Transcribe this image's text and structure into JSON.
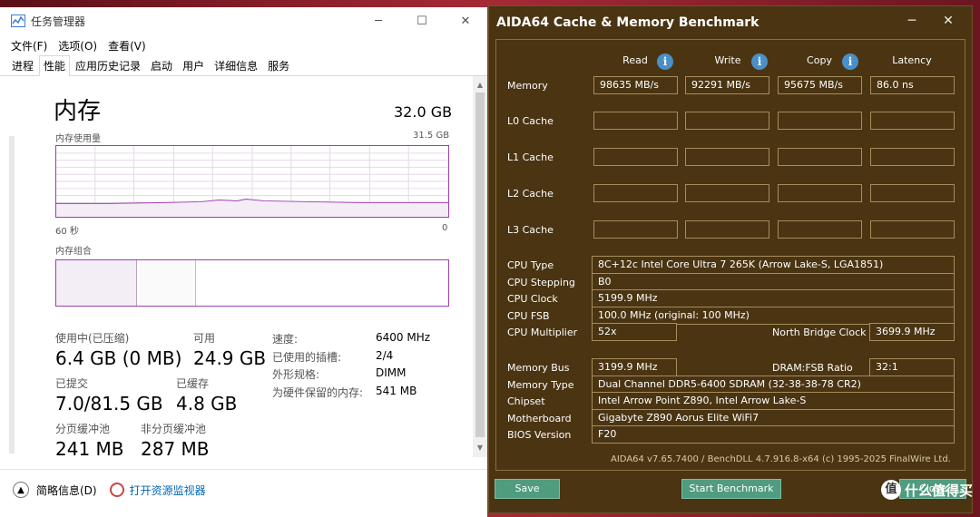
{
  "tm": {
    "title": "任务管理器",
    "menu": [
      "文件(F)",
      "选项(O)",
      "查看(V)"
    ],
    "tabs": [
      "进程",
      "性能",
      "应用历史记录",
      "启动",
      "用户",
      "详细信息",
      "服务"
    ],
    "active_tab": "性能",
    "heading": "内存",
    "total": "32.0 GB",
    "usage_label": "内存使用量",
    "usage_max": "31.5 GB",
    "axis_left": "60 秒",
    "axis_right": "0",
    "composition_label": "内存组合",
    "in_use_label": "使用中(已压缩)",
    "in_use_value": "6.4 GB (0 MB)",
    "available_label": "可用",
    "available_value": "24.9 GB",
    "committed_label": "已提交",
    "committed_value": "7.0/81.5 GB",
    "cached_label": "已缓存",
    "cached_value": "4.8 GB",
    "paged_label": "分页缓冲池",
    "paged_value": "241 MB",
    "nonpaged_label": "非分页缓冲池",
    "nonpaged_value": "287 MB",
    "speed_label": "速度:",
    "speed_value": "6400 MHz",
    "slots_label": "已使用的插槽:",
    "slots_value": "2/4",
    "form_label": "外形规格:",
    "form_value": "DIMM",
    "reserved_label": "为硬件保留的内存:",
    "reserved_value": "541 MB",
    "fewer_details": "简略信息(D)",
    "open_monitor": "打开资源监视器",
    "accent_color": "#9c3fae"
  },
  "aida": {
    "title": "AIDA64 Cache & Memory Benchmark",
    "col_read": "Read",
    "col_write": "Write",
    "col_copy": "Copy",
    "col_latency": "Latency",
    "memory_label": "Memory",
    "memory_read": "98635 MB/s",
    "memory_write": "92291 MB/s",
    "memory_copy": "95675 MB/s",
    "memory_latency": "86.0 ns",
    "l0_label": "L0 Cache",
    "l1_label": "L1 Cache",
    "l2_label": "L2 Cache",
    "l3_label": "L3 Cache",
    "cpu_type_label": "CPU Type",
    "cpu_type": "8C+12c Intel Core Ultra 7 265K  (Arrow Lake-S, LGA1851)",
    "cpu_stepping_label": "CPU Stepping",
    "cpu_stepping": "B0",
    "cpu_clock_label": "CPU Clock",
    "cpu_clock": "5199.9 MHz",
    "cpu_fsb_label": "CPU FSB",
    "cpu_fsb": "100.0 MHz  (original: 100 MHz)",
    "cpu_mult_label": "CPU Multiplier",
    "cpu_mult": "52x",
    "nb_clock_label": "North Bridge Clock",
    "nb_clock": "3699.9 MHz",
    "mem_bus_label": "Memory Bus",
    "mem_bus": "3199.9 MHz",
    "dram_ratio_label": "DRAM:FSB Ratio",
    "dram_ratio": "32:1",
    "mem_type_label": "Memory Type",
    "mem_type": "Dual Channel DDR5-6400 SDRAM  (32-38-38-78 CR2)",
    "chipset_label": "Chipset",
    "chipset": "Intel Arrow Point Z890, Intel Arrow Lake-S",
    "mobo_label": "Motherboard",
    "mobo": "Gigabyte Z890 Aorus Elite WiFi7",
    "bios_label": "BIOS Version",
    "bios": "F20",
    "footer": "AIDA64 v7.65.7400 / BenchDLL 4.7.916.8-x64  (c) 1995-2025 FinalWire Ltd.",
    "save": "Save",
    "start": "Start Benchmark",
    "close": "Close",
    "watermark": "什么值得买"
  }
}
